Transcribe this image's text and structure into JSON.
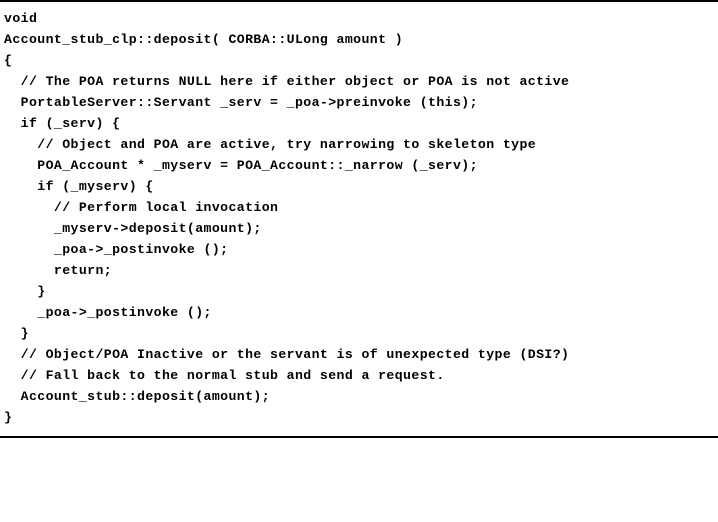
{
  "code": {
    "lines": [
      "void",
      "Account_stub_clp::deposit( CORBA::ULong amount )",
      "{",
      "  // The POA returns NULL here if either object or POA is not active",
      "  PortableServer::Servant _serv = _poa->preinvoke (this);",
      "",
      "  if (_serv) {",
      "    // Object and POA are active, try narrowing to skeleton type",
      "    POA_Account * _myserv = POA_Account::_narrow (_serv);",
      "    if (_myserv) {",
      "      // Perform local invocation",
      "      _myserv->deposit(amount);",
      "      _poa->_postinvoke ();",
      "      return;",
      "    }",
      "    _poa->_postinvoke ();",
      "  }",
      "",
      "  // Object/POA Inactive or the servant is of unexpected type (DSI?)",
      "  // Fall back to the normal stub and send a request.",
      "",
      "  Account_stub::deposit(amount);",
      "}"
    ]
  }
}
